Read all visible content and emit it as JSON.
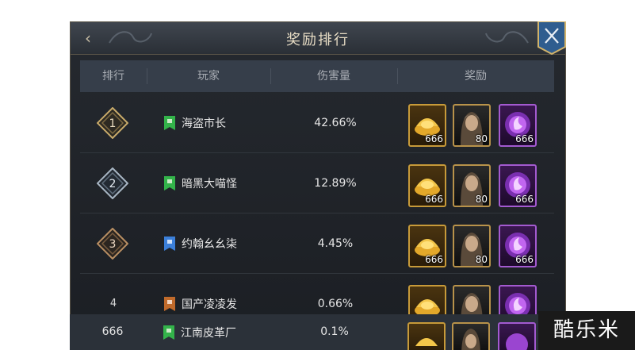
{
  "window": {
    "title": "奖励排行"
  },
  "table": {
    "headers": {
      "rank": "排行",
      "player": "玩家",
      "damage": "伤害量",
      "reward": "奖励"
    },
    "rows": [
      {
        "rank": "1",
        "rank_style": "badge",
        "flag_icon": "green-flag-icon",
        "player": "海盗市长",
        "damage": "42.66%",
        "rewards": [
          {
            "icon": "gold-ingot-icon",
            "qty": "666"
          },
          {
            "icon": "hero-portrait-icon",
            "qty": "80"
          },
          {
            "icon": "purple-orb-icon",
            "qty": "666"
          }
        ]
      },
      {
        "rank": "2",
        "rank_style": "badge",
        "flag_icon": "green-flag-icon",
        "player": "暗黑大喵怪",
        "damage": "12.89%",
        "rewards": [
          {
            "icon": "gold-ingot-icon",
            "qty": "666"
          },
          {
            "icon": "hero-portrait-icon",
            "qty": "80"
          },
          {
            "icon": "purple-orb-icon",
            "qty": "666"
          }
        ]
      },
      {
        "rank": "3",
        "rank_style": "badge",
        "flag_icon": "blue-flag-icon",
        "player": "约翰幺幺柒",
        "damage": "4.45%",
        "rewards": [
          {
            "icon": "gold-ingot-icon",
            "qty": "666"
          },
          {
            "icon": "hero-portrait-icon",
            "qty": "80"
          },
          {
            "icon": "purple-orb-icon",
            "qty": "666"
          }
        ]
      },
      {
        "rank": "4",
        "rank_style": "plain",
        "flag_icon": "orange-flag-icon",
        "player": "国产凌凌发",
        "damage": "0.66%",
        "rewards": [
          {
            "icon": "gold-ingot-icon",
            "qty": ""
          },
          {
            "icon": "hero-portrait-icon",
            "qty": ""
          },
          {
            "icon": "purple-orb-icon",
            "qty": ""
          }
        ]
      }
    ],
    "self_row": {
      "rank": "666",
      "flag_icon": "green-flag-icon",
      "player": "江南皮革厂",
      "damage": "0.1%"
    }
  },
  "colors": {
    "flag_green": "#33b34a",
    "flag_blue": "#3b7fd9",
    "flag_orange": "#c06a2b",
    "gold_border": "#c79a39",
    "orb_border": "#a35ad0"
  },
  "watermark": {
    "text": "酷乐米"
  }
}
